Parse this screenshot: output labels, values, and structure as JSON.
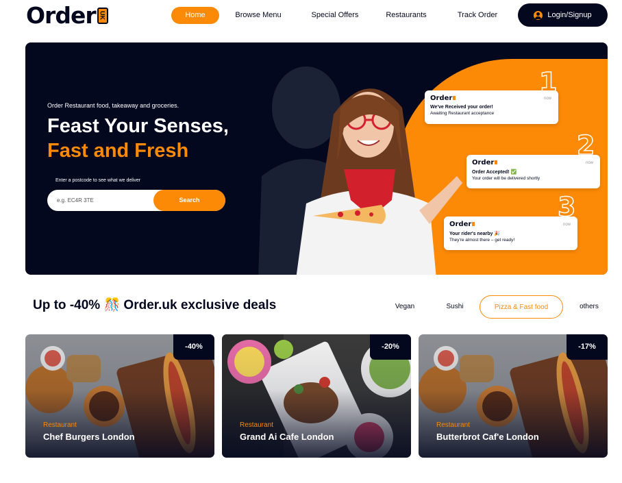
{
  "brand": {
    "logo_text": "Order",
    "logo_badge": "UK"
  },
  "nav": {
    "items": [
      {
        "label": "Home",
        "active": true
      },
      {
        "label": "Browse Menu"
      },
      {
        "label": "Special Offers"
      },
      {
        "label": "Restaurants"
      },
      {
        "label": "Track Order"
      }
    ],
    "login_label": "Login/Signup"
  },
  "hero": {
    "subtitle": "Order Restaurant food, takeaway and groceries.",
    "title_line1": "Feast Your Senses,",
    "title_line2": "Fast and Fresh",
    "postcode_hint": "Enter a postcode to see what we deliver",
    "search_placeholder": "e.g. EC4R 3TE",
    "search_button": "Search",
    "notifications": [
      {
        "step": "1",
        "logo": "Order",
        "time": "now",
        "title": "We've Received your order!",
        "text": "Awaiting Restaurant acceptance"
      },
      {
        "step": "2",
        "logo": "Order",
        "time": "now",
        "title": "Order Accepted! ✅",
        "text": "Your order will be delivered shortly"
      },
      {
        "step": "3",
        "logo": "Order",
        "time": "now",
        "title": "Your rider's nearby 🎉",
        "text": "They're almost there – get ready!"
      }
    ]
  },
  "deals": {
    "title_prefix": "Up to -40%",
    "title_emoji": "🎊",
    "title_suffix": "Order.uk exclusive deals",
    "filters": [
      {
        "label": "Vegan"
      },
      {
        "label": "Sushi"
      },
      {
        "label": "Pizza & Fast food",
        "active": true
      },
      {
        "label": "others"
      }
    ],
    "cards": [
      {
        "discount": "-40%",
        "category": "Restaurant",
        "name": "Chef Burgers London"
      },
      {
        "discount": "-20%",
        "category": "Restaurant",
        "name": "Grand Ai Cafe London"
      },
      {
        "discount": "-17%",
        "category": "Restaurant",
        "name": "Butterbrot Caf'e London"
      }
    ]
  },
  "colors": {
    "brand_orange": "#fc8a06",
    "navy": "#03081f"
  }
}
